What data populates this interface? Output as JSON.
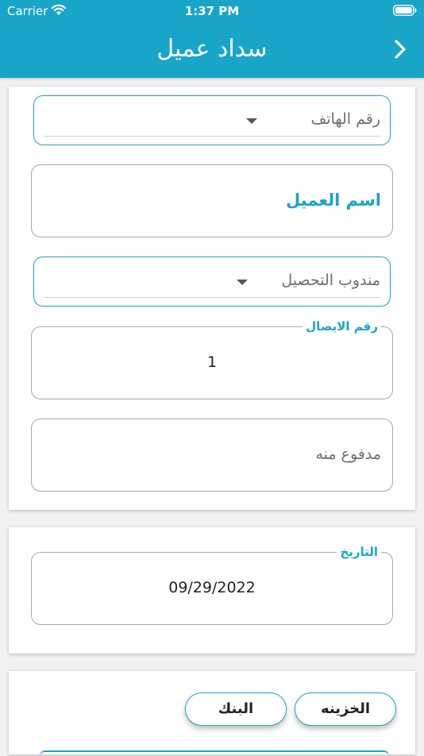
{
  "status_bar": {
    "carrier": "Carrier",
    "time": "1:37 PM"
  },
  "header": {
    "title": "سداد عميل",
    "back_icon": "chevron-right-icon"
  },
  "form": {
    "phone_dropdown": {
      "placeholder": "رقم الهاتف"
    },
    "customer_name_label": "اسم العميل",
    "collector_dropdown": {
      "placeholder": "مندوب التحصيل"
    },
    "receipt_number": {
      "label": "رقم الايصال",
      "value": "1"
    },
    "paid_by": {
      "placeholder": "مدفوع منه"
    }
  },
  "date_section": {
    "label": "التاريخ",
    "value": "09/29/2022"
  },
  "payment_source": {
    "treasury_label": "الخزينه",
    "bank_label": "البنك"
  },
  "colors": {
    "accent": "#19a5c8",
    "border": "#a8a8a8",
    "background": "#f2f2f2"
  }
}
